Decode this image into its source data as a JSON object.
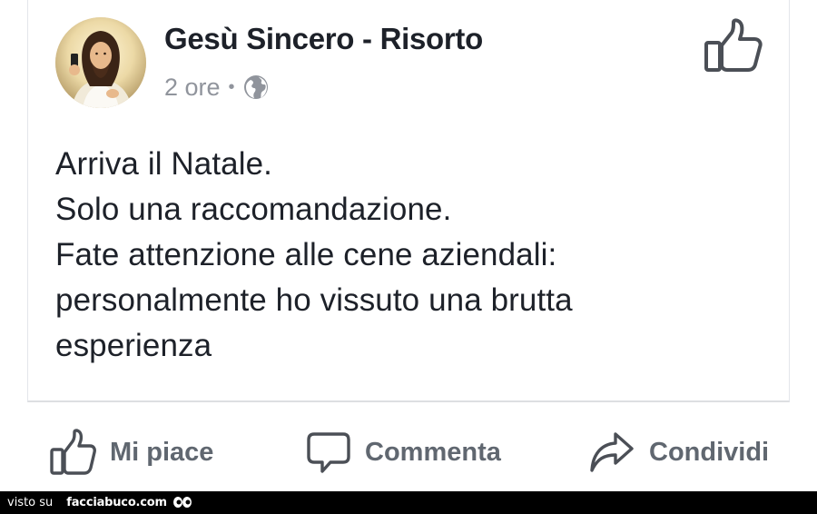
{
  "post": {
    "author": "Gesù Sincero - Risorto",
    "timestamp": "2 ore",
    "separator": "•",
    "privacy_icon": "globe-icon",
    "header_action_icon": "thumbs-up-icon",
    "text_lines": [
      "Arriva il Natale.",
      "Solo una raccomandazione.",
      "Fate attenzione alle cene aziendali:",
      "personalmente ho vissuto una brutta",
      "esperienza"
    ]
  },
  "actions": {
    "like": {
      "label": "Mi piace",
      "icon": "thumbs-up-icon"
    },
    "comment": {
      "label": "Commenta",
      "icon": "speech-bubble-icon"
    },
    "share": {
      "label": "Condividi",
      "icon": "share-arrow-icon"
    }
  },
  "footer": {
    "prefix": "visto su",
    "site": "facciabuco.com",
    "logo_icon": "eyes-icon"
  },
  "colors": {
    "text_primary": "#1d2129",
    "text_secondary": "#90949c",
    "action_text": "#606770",
    "icon_gray": "#4b4f56",
    "footer_background": "#000000"
  }
}
